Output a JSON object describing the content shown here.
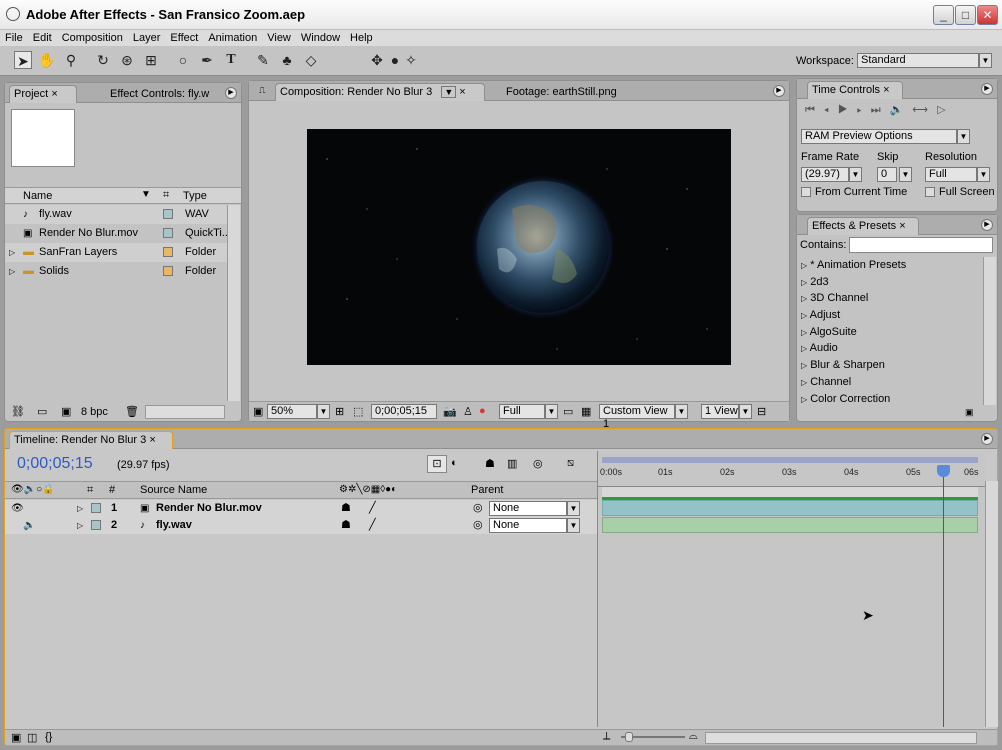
{
  "window": {
    "title": "Adobe After Effects - San Fransico Zoom.aep"
  },
  "menu": [
    "File",
    "Edit",
    "Composition",
    "Layer",
    "Effect",
    "Animation",
    "View",
    "Window",
    "Help"
  ],
  "workspace": {
    "label": "Workspace:",
    "value": "Standard"
  },
  "project": {
    "tab_project": "Project",
    "tab_effect_controls": "Effect Controls: fly.w",
    "col_name": "Name",
    "col_type": "Type",
    "items": [
      {
        "name": "fly.wav",
        "type": "WAV",
        "icon": "audio-file-icon",
        "swatch": "#a8c4c8"
      },
      {
        "name": "Render No Blur.mov",
        "type": "QuickTi..",
        "icon": "movie-file-icon",
        "swatch": "#a8c4c8"
      },
      {
        "name": "SanFran Layers",
        "type": "Folder",
        "icon": "folder-icon",
        "swatch": "#e6b866"
      },
      {
        "name": "Solids",
        "type": "Folder",
        "icon": "folder-icon",
        "swatch": "#e6b866"
      }
    ],
    "bpc": "8 bpc"
  },
  "composition": {
    "tab_label": "Composition: Render No Blur 3",
    "footage_tab": "Footage: earthStill.png",
    "zoom": "50%",
    "timecode": "0;00;05;15",
    "resolution": "Full",
    "view": "Custom View 1",
    "views": "1 View"
  },
  "time_controls": {
    "tab": "Time Controls",
    "preview_options": "RAM Preview Options",
    "frame_rate_label": "Frame Rate",
    "skip_label": "Skip",
    "resolution_label": "Resolution",
    "frame_rate": "(29.97)",
    "skip": "0",
    "resolution": "Full",
    "from_current": "From Current Time",
    "full_screen": "Full Screen"
  },
  "effects_presets": {
    "tab": "Effects & Presets",
    "contains_label": "Contains:",
    "items": [
      "* Animation Presets",
      "2d3",
      "3D Channel",
      "Adjust",
      "AlgoSuite",
      "Audio",
      "Blur & Sharpen",
      "Channel",
      "Color Correction"
    ]
  },
  "timeline": {
    "tab": "Timeline: Render No Blur 3",
    "timecode": "0;00;05;15",
    "fps": "(29.97 fps)",
    "col_hash": "#",
    "col_source": "Source Name",
    "col_parent": "Parent",
    "ticks": [
      "0:00s",
      "01s",
      "02s",
      "03s",
      "04s",
      "05s",
      "06s"
    ],
    "layers": [
      {
        "num": "1",
        "name": "Render No Blur.mov",
        "parent": "None",
        "icon": "comp-layer-icon"
      },
      {
        "num": "2",
        "name": "fly.wav",
        "parent": "None",
        "icon": "audio-layer-icon"
      }
    ],
    "playhead_seconds": 5.5
  }
}
